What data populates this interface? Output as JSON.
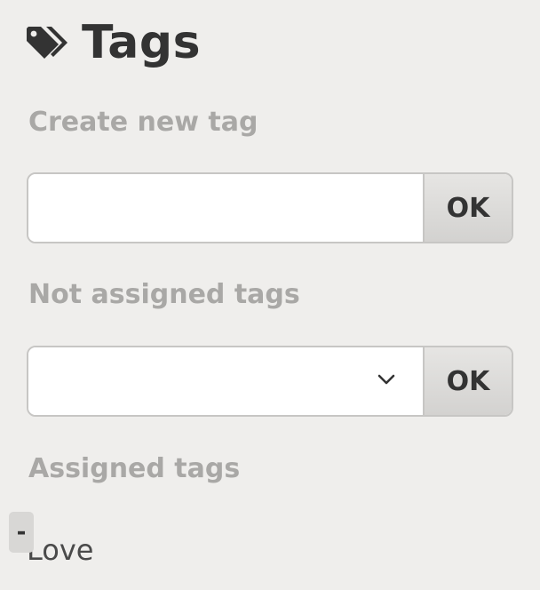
{
  "header": {
    "title": "Tags",
    "icon": "tags-icon"
  },
  "create_section": {
    "label": "Create new tag",
    "input_value": "",
    "input_placeholder": "",
    "ok_label": "OK"
  },
  "not_assigned_section": {
    "label": "Not assigned tags",
    "selected_value": "",
    "ok_label": "OK"
  },
  "assigned_section": {
    "label": "Assigned tags",
    "tags": [
      {
        "name": "Love",
        "remove_label": "-"
      }
    ]
  },
  "colors": {
    "background": "#efeeec",
    "title": "#333333",
    "section_label": "#a9a8a6",
    "border": "#c7c6c4"
  }
}
